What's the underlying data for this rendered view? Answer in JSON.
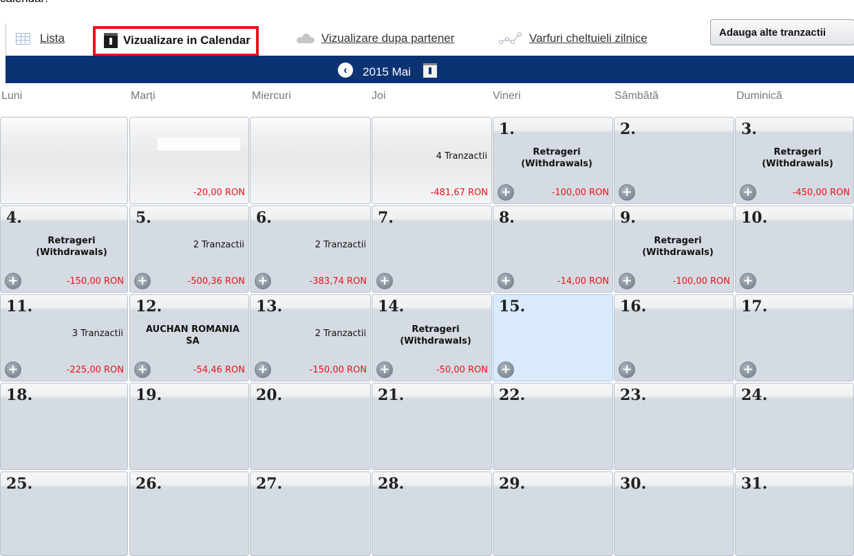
{
  "page_header": "calendar:",
  "views": [
    {
      "label": "Lista",
      "icon": "list-grid-icon"
    },
    {
      "label": "Vizualizare in Calendar",
      "icon": "calendar-icon",
      "active": true
    },
    {
      "label": "Vizualizare dupa partener",
      "icon": "cloud-icon"
    },
    {
      "label": "Varfuri cheltuieli zilnice",
      "icon": "peaks-chart-icon"
    }
  ],
  "add_button_label": "Adauga alte tranzactii",
  "month": {
    "title": "2015 Mai",
    "prev_icon": "chevron-left-circle-icon",
    "picker_icon": "calendar-icon"
  },
  "weekdays": [
    "Luni",
    "Marți",
    "Miercuri",
    "Joi",
    "Vineri",
    "Sâmbătă",
    "Duminică"
  ],
  "colors": {
    "header_bar": "#0b3272",
    "negative_amount": "#e8121b",
    "active_highlight": "#e8121b",
    "today": "#d8eafc"
  },
  "plus_glyph": "+",
  "prefix_cells": [
    {
      "label": "",
      "amount": ""
    },
    {
      "label": "",
      "amount": "-20,00 RON"
    },
    {
      "label": "",
      "amount": ""
    },
    {
      "label": "4 Tranzactii",
      "amount": "-481,67 RON"
    }
  ],
  "days": [
    {
      "day": "1.",
      "label": "Retrageri (Withdrawals)",
      "bold": true,
      "amount": "-100,00 RON"
    },
    {
      "day": "2.",
      "label": "",
      "amount": ""
    },
    {
      "day": "3.",
      "label": "Retrageri (Withdrawals)",
      "bold": true,
      "amount": "-450,00 RON"
    },
    {
      "day": "4.",
      "label": "Retrageri (Withdrawals)",
      "bold": true,
      "amount": "-150,00 RON"
    },
    {
      "day": "5.",
      "label": "2 Tranzactii",
      "amount": "-500,36 RON"
    },
    {
      "day": "6.",
      "label": "2 Tranzactii",
      "amount": "-383,74 RON"
    },
    {
      "day": "7.",
      "label": "",
      "amount": ""
    },
    {
      "day": "8.",
      "label": "",
      "amount": "-14,00 RON"
    },
    {
      "day": "9.",
      "label": "Retrageri (Withdrawals)",
      "bold": true,
      "amount": "-100,00 RON"
    },
    {
      "day": "10.",
      "label": "",
      "amount": ""
    },
    {
      "day": "11.",
      "label": "3 Tranzactii",
      "amount": "-225,00 RON"
    },
    {
      "day": "12.",
      "label": "AUCHAN ROMANIA SA",
      "bold": true,
      "amount": "-54,46 RON"
    },
    {
      "day": "13.",
      "label": "2 Tranzactii",
      "amount": "-150,00 RON"
    },
    {
      "day": "14.",
      "label": "Retrageri (Withdrawals)",
      "bold": true,
      "amount": "-50,00 RON"
    },
    {
      "day": "15.",
      "label": "",
      "amount": "",
      "today": true
    },
    {
      "day": "16.",
      "label": "",
      "amount": ""
    },
    {
      "day": "17.",
      "label": "",
      "amount": ""
    },
    {
      "day": "18.",
      "label": "",
      "amount": ""
    },
    {
      "day": "19.",
      "label": "",
      "amount": ""
    },
    {
      "day": "20.",
      "label": "",
      "amount": ""
    },
    {
      "day": "21.",
      "label": "",
      "amount": ""
    },
    {
      "day": "22.",
      "label": "",
      "amount": ""
    },
    {
      "day": "23.",
      "label": "",
      "amount": ""
    },
    {
      "day": "24.",
      "label": "",
      "amount": ""
    },
    {
      "day": "25.",
      "label": "",
      "amount": ""
    },
    {
      "day": "26.",
      "label": "",
      "amount": ""
    },
    {
      "day": "27.",
      "label": "",
      "amount": ""
    },
    {
      "day": "28.",
      "label": "",
      "amount": ""
    },
    {
      "day": "29.",
      "label": "",
      "amount": ""
    },
    {
      "day": "30.",
      "label": "",
      "amount": ""
    },
    {
      "day": "31.",
      "label": "",
      "amount": ""
    }
  ]
}
